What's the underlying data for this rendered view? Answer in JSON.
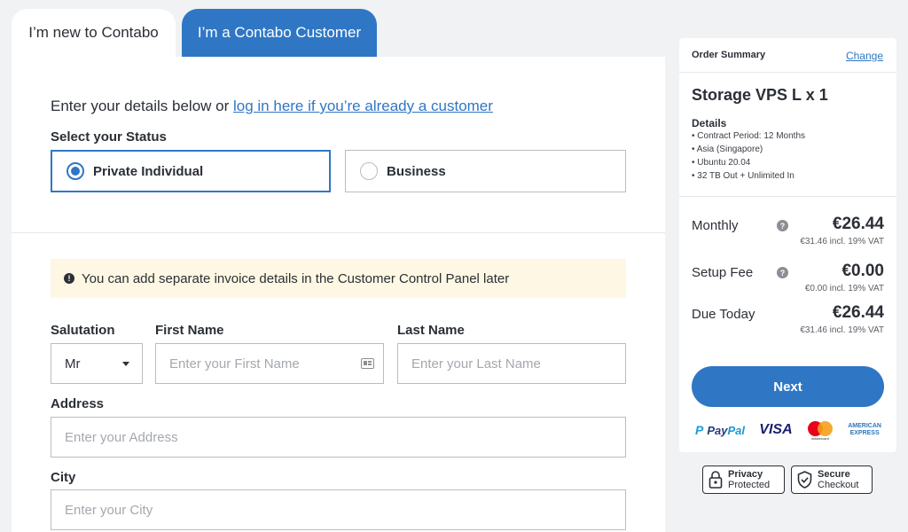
{
  "tabs": {
    "new_label": "I’m new to Contabo",
    "customer_label": "I’m a Contabo Customer"
  },
  "form": {
    "intro_text": "Enter your details below or ",
    "login_link": "log in here if you’re already a customer",
    "status_label": "Select your Status",
    "status_options": [
      {
        "label": "Private Individual",
        "selected": true
      },
      {
        "label": "Business",
        "selected": false
      }
    ],
    "notice": "You can add separate invoice details in the Customer Control Panel later",
    "salutation_label": "Salutation",
    "salutation_value": "Mr",
    "first_name_label": "First Name",
    "first_name_placeholder": "Enter your First Name",
    "last_name_label": "Last Name",
    "last_name_placeholder": "Enter your Last Name",
    "address_label": "Address",
    "address_placeholder": "Enter your Address",
    "city_label": "City",
    "city_placeholder": "Enter your City"
  },
  "summary": {
    "title": "Order Summary",
    "change_label": "Change",
    "product": "Storage VPS L x 1",
    "details_title": "Details",
    "details": [
      "Contract Period: 12 Months",
      "Asia (Singapore)",
      "Ubuntu 20.04",
      "32 TB Out + Unlimited In"
    ],
    "prices": [
      {
        "label": "Monthly",
        "value": "€26.44",
        "vat": "€31.46 incl. 19% VAT",
        "help": "?"
      },
      {
        "label": "Setup Fee",
        "value": "€0.00",
        "vat": "€0.00 incl. 19% VAT",
        "help": "?"
      },
      {
        "label": "Due Today",
        "value": "€26.44",
        "vat": "€31.46 incl. 19% VAT"
      }
    ],
    "next_label": "Next",
    "payment": {
      "paypal_pay": "Pay",
      "paypal_pal": "Pal",
      "visa": "VISA",
      "mastercard": "mastercard",
      "amex_line1": "AMERICAN",
      "amex_line2": "EXPRESS"
    }
  },
  "badges": {
    "privacy_line1": "Privacy",
    "privacy_line2": "Protected",
    "secure_line1": "Secure",
    "secure_line2": "Checkout"
  },
  "colors": {
    "accent": "#2f77c4",
    "notice_bg": "#fdf7e3",
    "page_bg": "#f1f2f4"
  }
}
